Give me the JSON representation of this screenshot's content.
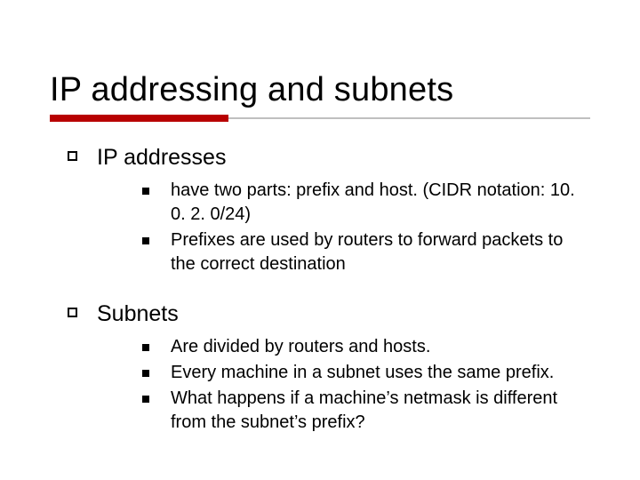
{
  "title": "IP addressing and subnets",
  "colors": {
    "accent": "#B80000",
    "rule_gray": "#BFBFBF"
  },
  "sections": [
    {
      "heading": "IP addresses",
      "items": [
        "have two parts: prefix and host. (CIDR notation: 10. 0. 2. 0/24)",
        "Prefixes are used by routers to forward packets to the correct destination"
      ]
    },
    {
      "heading": "Subnets",
      "items": [
        "Are divided by routers and hosts.",
        "Every machine in a subnet uses the same prefix.",
        "What happens if a machine’s netmask is different from the subnet’s prefix?"
      ]
    }
  ]
}
